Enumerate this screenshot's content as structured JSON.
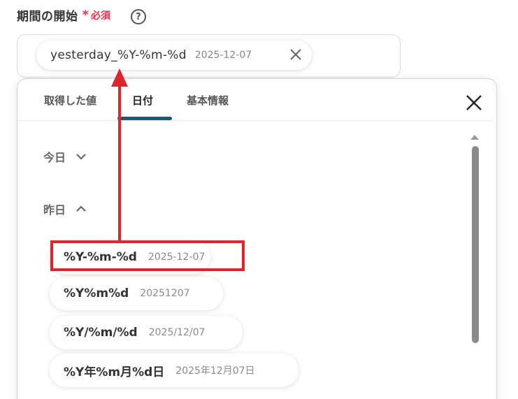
{
  "field": {
    "title": "期間の開始",
    "required_star": "*",
    "required_label": "必須",
    "help_icon": "?"
  },
  "input": {
    "token_value": "yesterday_%Y-%m-%d",
    "token_preview": "2025-12-07",
    "remove_icon": "close-icon"
  },
  "tabs": [
    {
      "label": "取得した値",
      "active": false
    },
    {
      "label": "日付",
      "active": true
    },
    {
      "label": "基本情報",
      "active": false
    }
  ],
  "groups": [
    {
      "label": "今日",
      "state": "collapsed",
      "icon": "chevron-down-icon"
    },
    {
      "label": "昨日",
      "state": "expanded",
      "icon": "chevron-up-icon"
    }
  ],
  "options": [
    {
      "format": "%Y-%m-%d",
      "preview": "2025-12-07",
      "highlighted": true
    },
    {
      "format": "%Y%m%d",
      "preview": "20251207",
      "highlighted": false
    },
    {
      "format": "%Y/%m/%d",
      "preview": "2025/12/07",
      "highlighted": false
    },
    {
      "format": "%Y年%m月%d日",
      "preview": "2025年12月07日",
      "highlighted": false
    }
  ],
  "colors": {
    "required": "#e8344e",
    "active_tab_underline": "#0f5d7a",
    "annotation": "#e0242c"
  }
}
